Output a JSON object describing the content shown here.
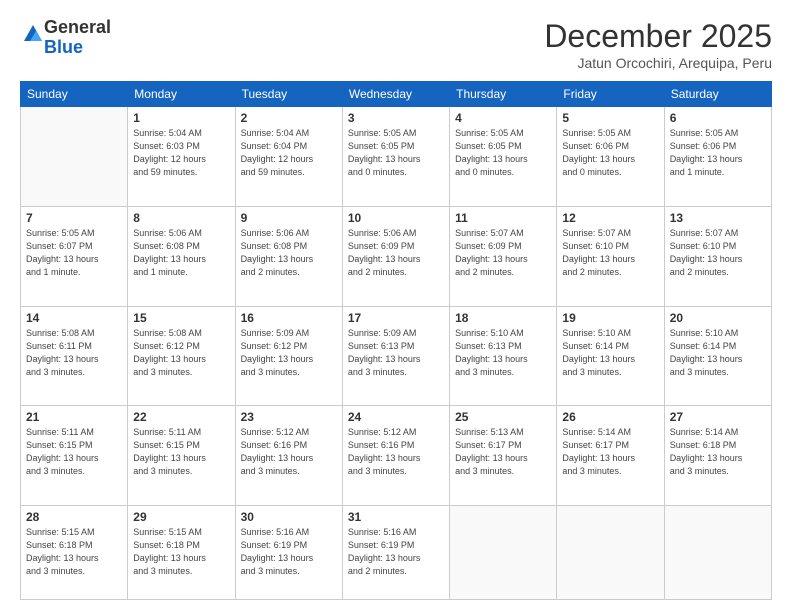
{
  "logo": {
    "general": "General",
    "blue": "Blue"
  },
  "title": {
    "month_year": "December 2025",
    "location": "Jatun Orcochiri, Arequipa, Peru"
  },
  "weekdays": [
    "Sunday",
    "Monday",
    "Tuesday",
    "Wednesday",
    "Thursday",
    "Friday",
    "Saturday"
  ],
  "weeks": [
    [
      {
        "day": "",
        "info": ""
      },
      {
        "day": "1",
        "info": "Sunrise: 5:04 AM\nSunset: 6:03 PM\nDaylight: 12 hours\nand 59 minutes."
      },
      {
        "day": "2",
        "info": "Sunrise: 5:04 AM\nSunset: 6:04 PM\nDaylight: 12 hours\nand 59 minutes."
      },
      {
        "day": "3",
        "info": "Sunrise: 5:05 AM\nSunset: 6:05 PM\nDaylight: 13 hours\nand 0 minutes."
      },
      {
        "day": "4",
        "info": "Sunrise: 5:05 AM\nSunset: 6:05 PM\nDaylight: 13 hours\nand 0 minutes."
      },
      {
        "day": "5",
        "info": "Sunrise: 5:05 AM\nSunset: 6:06 PM\nDaylight: 13 hours\nand 0 minutes."
      },
      {
        "day": "6",
        "info": "Sunrise: 5:05 AM\nSunset: 6:06 PM\nDaylight: 13 hours\nand 1 minute."
      }
    ],
    [
      {
        "day": "7",
        "info": "Sunrise: 5:05 AM\nSunset: 6:07 PM\nDaylight: 13 hours\nand 1 minute."
      },
      {
        "day": "8",
        "info": "Sunrise: 5:06 AM\nSunset: 6:08 PM\nDaylight: 13 hours\nand 1 minute."
      },
      {
        "day": "9",
        "info": "Sunrise: 5:06 AM\nSunset: 6:08 PM\nDaylight: 13 hours\nand 2 minutes."
      },
      {
        "day": "10",
        "info": "Sunrise: 5:06 AM\nSunset: 6:09 PM\nDaylight: 13 hours\nand 2 minutes."
      },
      {
        "day": "11",
        "info": "Sunrise: 5:07 AM\nSunset: 6:09 PM\nDaylight: 13 hours\nand 2 minutes."
      },
      {
        "day": "12",
        "info": "Sunrise: 5:07 AM\nSunset: 6:10 PM\nDaylight: 13 hours\nand 2 minutes."
      },
      {
        "day": "13",
        "info": "Sunrise: 5:07 AM\nSunset: 6:10 PM\nDaylight: 13 hours\nand 2 minutes."
      }
    ],
    [
      {
        "day": "14",
        "info": "Sunrise: 5:08 AM\nSunset: 6:11 PM\nDaylight: 13 hours\nand 3 minutes."
      },
      {
        "day": "15",
        "info": "Sunrise: 5:08 AM\nSunset: 6:12 PM\nDaylight: 13 hours\nand 3 minutes."
      },
      {
        "day": "16",
        "info": "Sunrise: 5:09 AM\nSunset: 6:12 PM\nDaylight: 13 hours\nand 3 minutes."
      },
      {
        "day": "17",
        "info": "Sunrise: 5:09 AM\nSunset: 6:13 PM\nDaylight: 13 hours\nand 3 minutes."
      },
      {
        "day": "18",
        "info": "Sunrise: 5:10 AM\nSunset: 6:13 PM\nDaylight: 13 hours\nand 3 minutes."
      },
      {
        "day": "19",
        "info": "Sunrise: 5:10 AM\nSunset: 6:14 PM\nDaylight: 13 hours\nand 3 minutes."
      },
      {
        "day": "20",
        "info": "Sunrise: 5:10 AM\nSunset: 6:14 PM\nDaylight: 13 hours\nand 3 minutes."
      }
    ],
    [
      {
        "day": "21",
        "info": "Sunrise: 5:11 AM\nSunset: 6:15 PM\nDaylight: 13 hours\nand 3 minutes."
      },
      {
        "day": "22",
        "info": "Sunrise: 5:11 AM\nSunset: 6:15 PM\nDaylight: 13 hours\nand 3 minutes."
      },
      {
        "day": "23",
        "info": "Sunrise: 5:12 AM\nSunset: 6:16 PM\nDaylight: 13 hours\nand 3 minutes."
      },
      {
        "day": "24",
        "info": "Sunrise: 5:12 AM\nSunset: 6:16 PM\nDaylight: 13 hours\nand 3 minutes."
      },
      {
        "day": "25",
        "info": "Sunrise: 5:13 AM\nSunset: 6:17 PM\nDaylight: 13 hours\nand 3 minutes."
      },
      {
        "day": "26",
        "info": "Sunrise: 5:14 AM\nSunset: 6:17 PM\nDaylight: 13 hours\nand 3 minutes."
      },
      {
        "day": "27",
        "info": "Sunrise: 5:14 AM\nSunset: 6:18 PM\nDaylight: 13 hours\nand 3 minutes."
      }
    ],
    [
      {
        "day": "28",
        "info": "Sunrise: 5:15 AM\nSunset: 6:18 PM\nDaylight: 13 hours\nand 3 minutes."
      },
      {
        "day": "29",
        "info": "Sunrise: 5:15 AM\nSunset: 6:18 PM\nDaylight: 13 hours\nand 3 minutes."
      },
      {
        "day": "30",
        "info": "Sunrise: 5:16 AM\nSunset: 6:19 PM\nDaylight: 13 hours\nand 3 minutes."
      },
      {
        "day": "31",
        "info": "Sunrise: 5:16 AM\nSunset: 6:19 PM\nDaylight: 13 hours\nand 2 minutes."
      },
      {
        "day": "",
        "info": ""
      },
      {
        "day": "",
        "info": ""
      },
      {
        "day": "",
        "info": ""
      }
    ]
  ]
}
